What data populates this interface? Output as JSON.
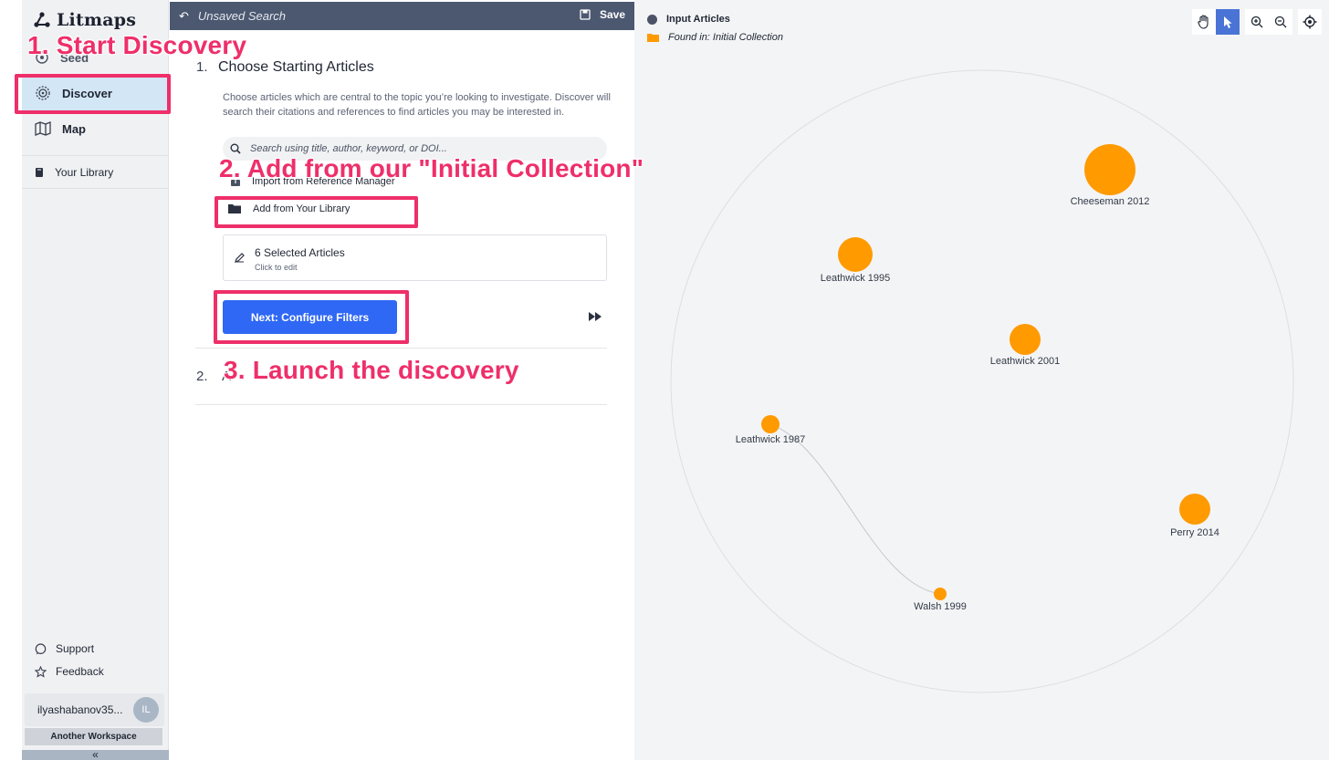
{
  "app": {
    "name": "Litmaps"
  },
  "sidebar": {
    "items": [
      {
        "label": "Seed"
      },
      {
        "label": "Discover"
      },
      {
        "label": "Map"
      }
    ],
    "library": "Your Library",
    "support": "Support",
    "feedback": "Feedback",
    "user": {
      "name": "ilyashabanov35...",
      "initials": "IL"
    },
    "workspace": "Another Workspace",
    "collapse": "«"
  },
  "topbar": {
    "back_icon": "undo-icon",
    "title": "Unsaved Search",
    "save_label": "Save"
  },
  "discover": {
    "step1_num": "1.",
    "step1_title": "Choose Starting Articles",
    "step1_desc": "Choose articles which are central to the topic you’re looking to investigate. Discover will search their citations and references to find articles you may be interested in.",
    "search_placeholder": "Search using title, author, keyword, or DOI...",
    "import_label": "Import from Reference Manager",
    "add_library_label": "Add from Your Library",
    "selected_title": "6 Selected Articles",
    "selected_sub": "Click to edit",
    "next_button": "Next: Configure Filters",
    "step2_num": "2.",
    "step2_fragment": "A"
  },
  "annotations": {
    "a1": "1. Start Discovery",
    "a2": "2. Add from our \"Initial Collection\"",
    "a3": "3. Launch the discovery"
  },
  "map": {
    "legend_input": "Input Articles",
    "legend_found": "Found in: Initial Collection",
    "node_color": "#ff9a00",
    "nodes": [
      {
        "label": "Cheeseman 2012"
      },
      {
        "label": "Leathwick 1995"
      },
      {
        "label": "Leathwick 2001"
      },
      {
        "label": "Leathwick 1987"
      },
      {
        "label": "Perry 2014"
      },
      {
        "label": "Walsh 1999"
      }
    ],
    "tools": [
      "hand-icon",
      "pointer-icon",
      "zoom-in-icon",
      "zoom-out-icon",
      "locate-icon"
    ]
  }
}
